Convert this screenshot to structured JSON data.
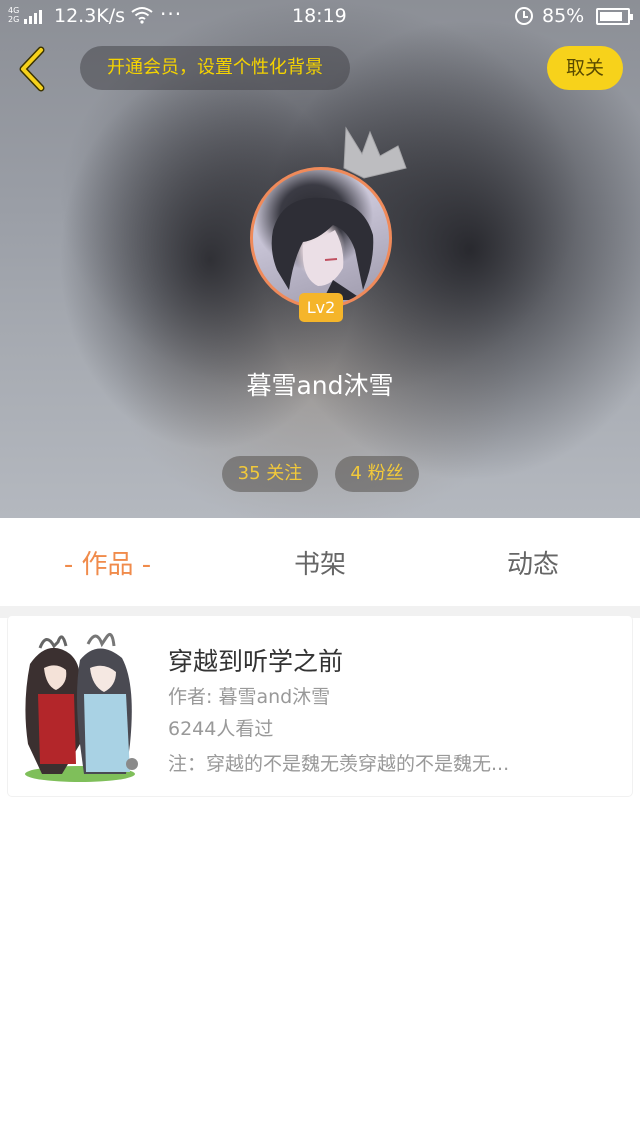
{
  "status_bar": {
    "network": "4G 2G",
    "speed": "12.3K/s",
    "dots": "···",
    "time": "18:19",
    "battery": "85%",
    "battery_level": 0.85
  },
  "header": {
    "vip_prompt": "开通会员，设置个性化背景",
    "unfollow_label": "取关",
    "level": "Lv2",
    "username": "暮雪and沐雪",
    "following": "35 关注",
    "fans": "4 粉丝"
  },
  "tabs": [
    {
      "label": "- 作品 -",
      "active": true
    },
    {
      "label": "书架",
      "active": false
    },
    {
      "label": "动态",
      "active": false
    }
  ],
  "works": [
    {
      "title": "穿越到听学之前",
      "author": "作者: 暮雪and沐雪",
      "views": "6244人看过",
      "description": "注：穿越的不是魏无羡穿越的不是魏无..."
    }
  ],
  "colors": {
    "accent_orange": "#f08b4b",
    "vip_yellow": "#f5d300",
    "button_yellow": "#f7d21b",
    "level_badge": "#f5b52a"
  }
}
